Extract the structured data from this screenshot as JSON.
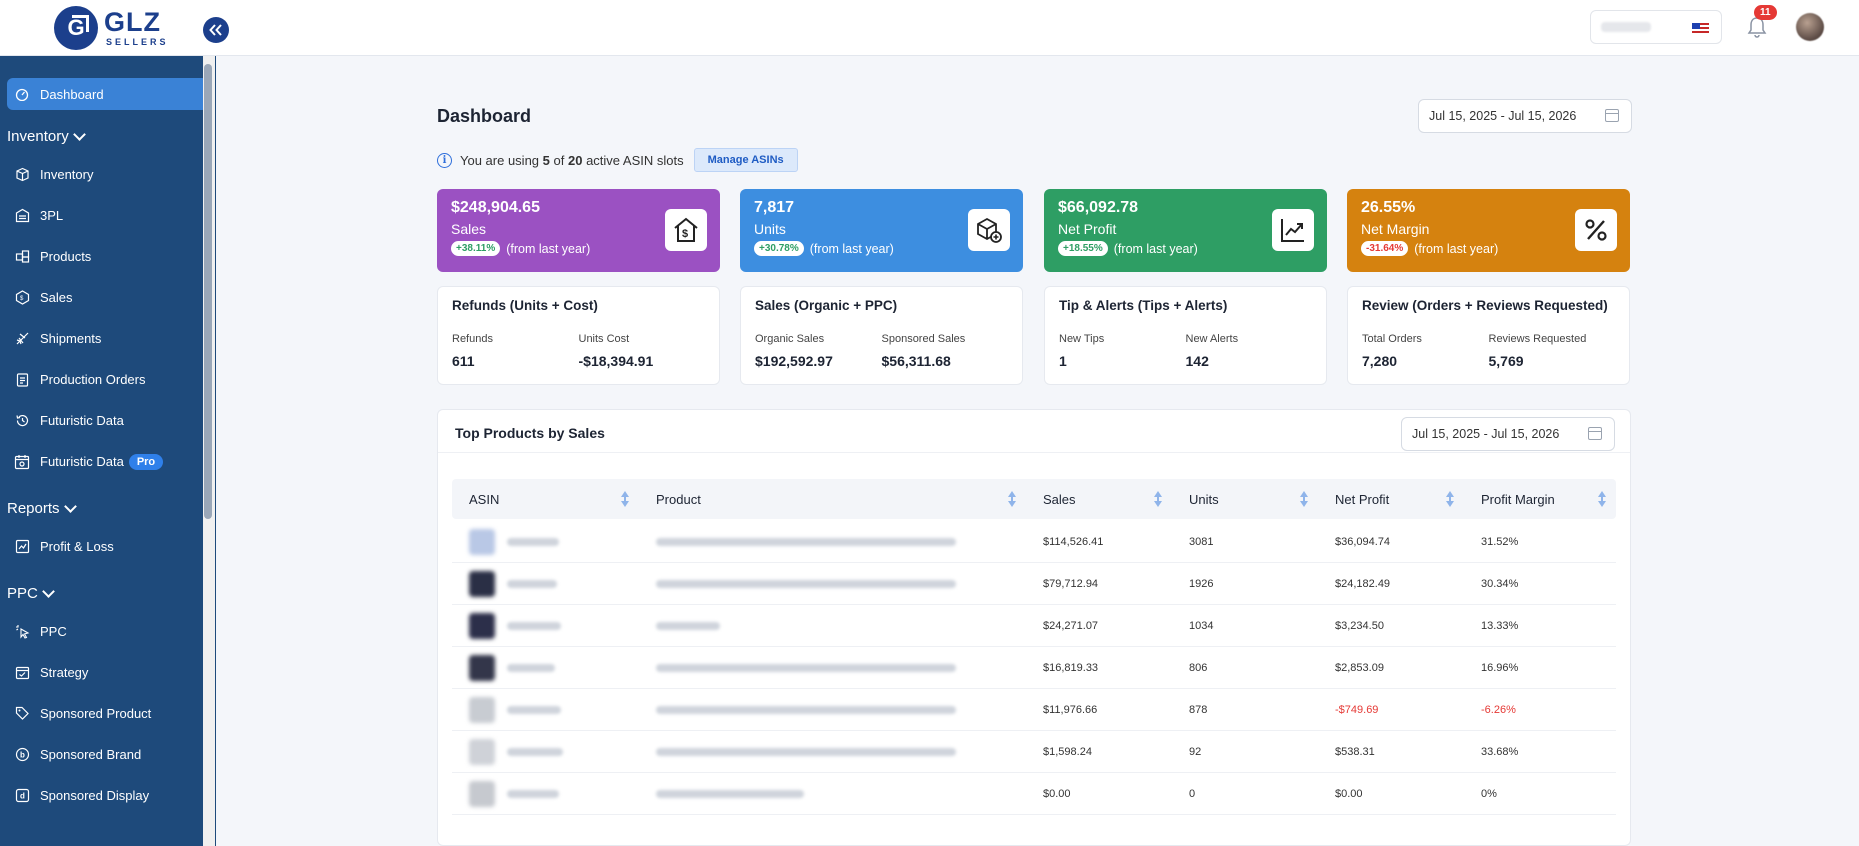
{
  "brand": {
    "name": "GLZ",
    "sub": "SELLERS"
  },
  "sidebar": {
    "dashboard": "Dashboard",
    "sections": [
      {
        "title": "Inventory",
        "items": [
          "Inventory",
          "3PL",
          "Products",
          "Sales",
          "Shipments",
          "Production Orders",
          "Futuristic Data",
          "Futuristic Data"
        ]
      },
      {
        "title": "Reports",
        "items": [
          "Profit & Loss"
        ]
      },
      {
        "title": "PPC",
        "items": [
          "PPC",
          "Strategy",
          "Sponsored Product",
          "Sponsored Brand",
          "Sponsored Display"
        ]
      }
    ],
    "pro_badge": "Pro"
  },
  "header": {
    "notifications": "11"
  },
  "page": {
    "title": "Dashboard",
    "date_range": "Jul 15, 2025 - Jul 15, 2026",
    "slots": {
      "prefix": "You are using",
      "used": "5",
      "of": "of",
      "total": "20",
      "suffix": "active ASIN slots",
      "button": "Manage ASINs"
    }
  },
  "kpis": [
    {
      "value": "$248,904.65",
      "label": "Sales",
      "change": "+38.11%",
      "note": "(from last year)",
      "color": "#9b51c2",
      "positive": true,
      "icon": "house-dollar-icon"
    },
    {
      "value": "7,817",
      "label": "Units",
      "change": "+30.78%",
      "note": "(from last year)",
      "color": "#3d8ee0",
      "positive": true,
      "icon": "box-add-icon"
    },
    {
      "value": "$66,092.78",
      "label": "Net Profit",
      "change": "+18.55%",
      "note": "(from last year)",
      "color": "#2e9e64",
      "positive": true,
      "icon": "chart-up-icon"
    },
    {
      "value": "26.55%",
      "label": "Net Margin",
      "change": "-31.64%",
      "note": "(from last year)",
      "color": "#d5820f",
      "positive": false,
      "icon": "percent-icon"
    }
  ],
  "cards": [
    {
      "title": "Refunds (Units + Cost)",
      "k1": "Refunds",
      "v1": "611",
      "k2": "Units Cost",
      "v2": "-$18,394.91"
    },
    {
      "title": "Sales (Organic + PPC)",
      "k1": "Organic Sales",
      "v1": "$192,592.97",
      "k2": "Sponsored Sales",
      "v2": "$56,311.68"
    },
    {
      "title": "Tip & Alerts (Tips + Alerts)",
      "k1": "New Tips",
      "v1": "1",
      "k2": "New Alerts",
      "v2": "142"
    },
    {
      "title": "Review (Orders + Reviews Requested)",
      "k1": "Total Orders",
      "v1": "7,280",
      "k2": "Reviews Requested",
      "v2": "5,769"
    }
  ],
  "top_products": {
    "title": "Top Products by Sales",
    "date_range": "Jul 15, 2025 - Jul 15, 2026",
    "columns": [
      "ASIN",
      "Product",
      "Sales",
      "Units",
      "Net Profit",
      "Profit Margin"
    ],
    "rows": [
      {
        "sales": "$114,526.41",
        "units": "3081",
        "net_profit": "$36,094.74",
        "margin": "31.52%",
        "negative": false
      },
      {
        "sales": "$79,712.94",
        "units": "1926",
        "net_profit": "$24,182.49",
        "margin": "30.34%",
        "negative": false
      },
      {
        "sales": "$24,271.07",
        "units": "1034",
        "net_profit": "$3,234.50",
        "margin": "13.33%",
        "negative": false
      },
      {
        "sales": "$16,819.33",
        "units": "806",
        "net_profit": "$2,853.09",
        "margin": "16.96%",
        "negative": false
      },
      {
        "sales": "$11,976.66",
        "units": "878",
        "net_profit": "-$749.69",
        "margin": "-6.26%",
        "negative": true
      },
      {
        "sales": "$1,598.24",
        "units": "92",
        "net_profit": "$538.31",
        "margin": "33.68%",
        "negative": false
      },
      {
        "sales": "$0.00",
        "units": "0",
        "net_profit": "$0.00",
        "margin": "0%",
        "negative": false
      }
    ]
  }
}
